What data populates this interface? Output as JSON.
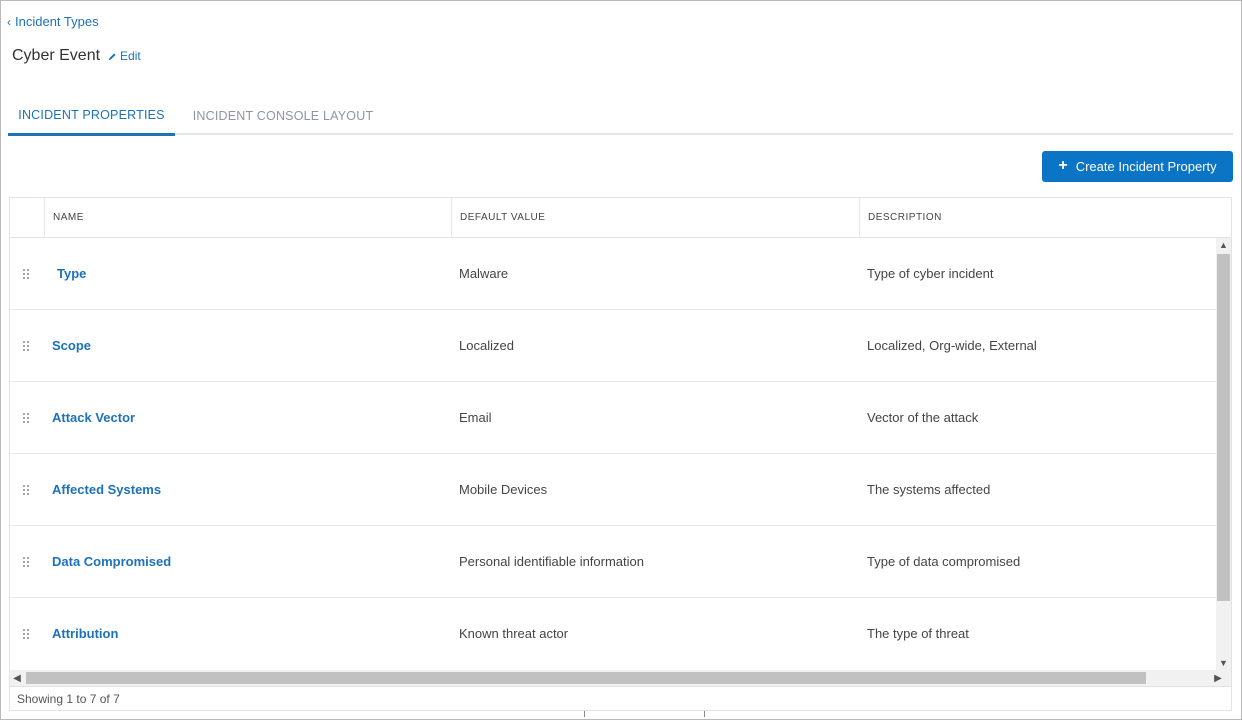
{
  "breadcrumb": {
    "chevron": "‹",
    "label": "Incident Types"
  },
  "header": {
    "title": "Cyber Event",
    "edit_label": "Edit"
  },
  "tabs": [
    {
      "label": "INCIDENT PROPERTIES",
      "active": true
    },
    {
      "label": "INCIDENT CONSOLE LAYOUT",
      "active": false
    }
  ],
  "toolbar": {
    "create_label": "Create Incident Property",
    "plus": "+"
  },
  "table": {
    "columns": [
      "NAME",
      "DEFAULT VALUE",
      "DESCRIPTION"
    ],
    "rows": [
      {
        "name": "Type",
        "default_value": "Malware",
        "description": "Type of cyber incident"
      },
      {
        "name": "Scope",
        "default_value": "Localized",
        "description": "Localized, Org-wide, External"
      },
      {
        "name": "Attack Vector",
        "default_value": "Email",
        "description": "Vector of the attack"
      },
      {
        "name": "Affected Systems",
        "default_value": "Mobile Devices",
        "description": "The systems affected"
      },
      {
        "name": "Data Compromised",
        "default_value": "Personal identifiable information",
        "description": "Type of data compromised"
      },
      {
        "name": "Attribution",
        "default_value": "Known threat actor",
        "description": "The type of threat"
      }
    ],
    "footer": "Showing 1 to 7 of 7"
  },
  "scroll": {
    "up": "▲",
    "down": "▼",
    "left": "◀",
    "right": "▶"
  },
  "colors": {
    "accent": "#1d72b8",
    "button": "#0b74c4",
    "border": "#dfe3e7"
  },
  "icons": [
    "chevron-left-icon",
    "pencil-icon",
    "plus-icon",
    "drag-handle-icon"
  ]
}
